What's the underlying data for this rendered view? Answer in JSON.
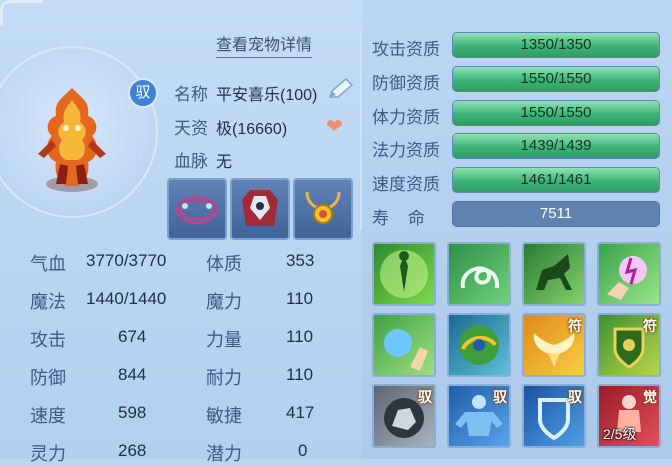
{
  "header": {
    "view_details_label": "查看宠物详情"
  },
  "pet": {
    "badge": "驭",
    "name_label": "名称",
    "name_value": "平安喜乐(100)",
    "talent_label": "天资",
    "talent_value": "极(16660)",
    "bloodline_label": "血脉",
    "bloodline_value": "无"
  },
  "stats": [
    {
      "label": "气血",
      "value": "3770/3770"
    },
    {
      "label": "魔法",
      "value": "1440/1440"
    },
    {
      "label": "攻击",
      "value": "674"
    },
    {
      "label": "防御",
      "value": "844"
    },
    {
      "label": "速度",
      "value": "598"
    },
    {
      "label": "灵力",
      "value": "268"
    }
  ],
  "attributes": [
    {
      "label": "体质",
      "value": "353"
    },
    {
      "label": "魔力",
      "value": "110"
    },
    {
      "label": "力量",
      "value": "110"
    },
    {
      "label": "耐力",
      "value": "110"
    },
    {
      "label": "敏捷",
      "value": "417"
    },
    {
      "label": "潜力",
      "value": "0"
    }
  ],
  "aptitudes": [
    {
      "label": "攻击资质",
      "value": "1350/1350",
      "fill": 1.0
    },
    {
      "label": "防御资质",
      "value": "1550/1550",
      "fill": 1.0
    },
    {
      "label": "体力资质",
      "value": "1550/1550",
      "fill": 1.0
    },
    {
      "label": "法力资质",
      "value": "1439/1439",
      "fill": 1.0
    },
    {
      "label": "速度资质",
      "value": "1461/1461",
      "fill": 1.0
    }
  ],
  "lifespan": {
    "label": "寿    命",
    "value": "7511"
  },
  "skills": {
    "tag_fu": "符",
    "tag_yu": "驭",
    "tag_jue": "觉",
    "awaken_level": "2/5级"
  },
  "colors": {
    "bar_green": "#3fb478",
    "accent_blue": "#3f83d4"
  }
}
